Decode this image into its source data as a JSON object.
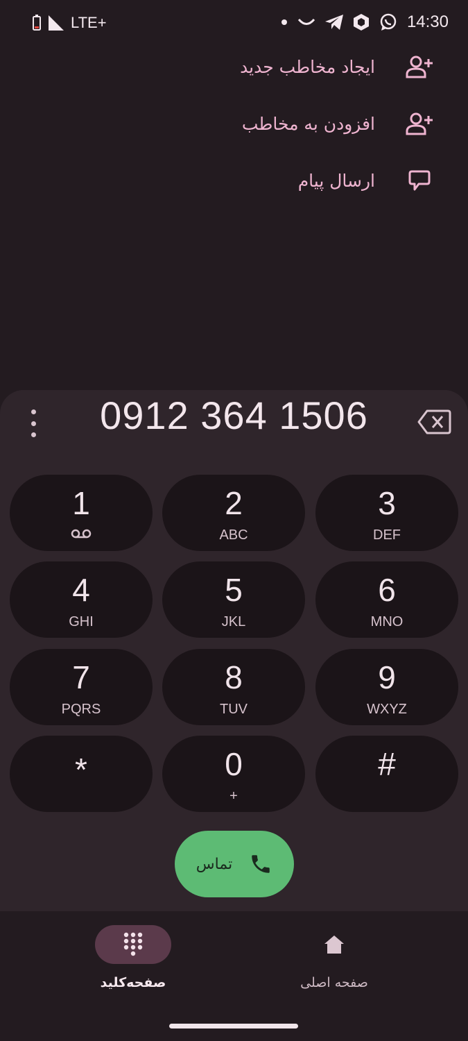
{
  "status_bar": {
    "network": "LTE+",
    "time": "14:30"
  },
  "actions": [
    {
      "label": "ایجاد مخاطب جدید",
      "icon": "person-add-icon"
    },
    {
      "label": "افزودن به مخاطب",
      "icon": "person-add-icon"
    },
    {
      "label": "ارسال پیام",
      "icon": "message-icon"
    }
  ],
  "dialer": {
    "number": "0912 364 1506",
    "keys": [
      {
        "digit": "1",
        "sub": ""
      },
      {
        "digit": "2",
        "sub": "ABC"
      },
      {
        "digit": "3",
        "sub": "DEF"
      },
      {
        "digit": "4",
        "sub": "GHI"
      },
      {
        "digit": "5",
        "sub": "JKL"
      },
      {
        "digit": "6",
        "sub": "MNO"
      },
      {
        "digit": "7",
        "sub": "PQRS"
      },
      {
        "digit": "8",
        "sub": "TUV"
      },
      {
        "digit": "9",
        "sub": "WXYZ"
      },
      {
        "digit": "*",
        "sub": ""
      },
      {
        "digit": "0",
        "sub": "+"
      },
      {
        "digit": "#",
        "sub": ""
      }
    ],
    "call_label": "تماس"
  },
  "nav": {
    "keypad_label": "صفحه‌کلید",
    "home_label": "صفحه اصلی"
  },
  "colors": {
    "background": "#231b20",
    "sheet": "#2f252b",
    "key": "#1b1418",
    "accent_text": "#efb4d0",
    "call": "#5dbb74",
    "nav_pill_active": "#5b3a4b"
  }
}
